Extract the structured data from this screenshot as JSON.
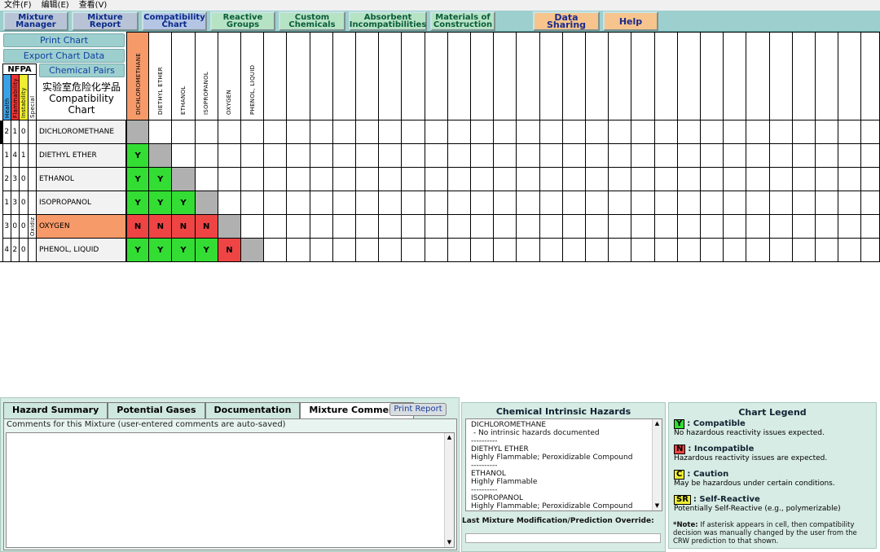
{
  "menu": [
    "文件(F)",
    "编辑(E)",
    "查看(V)"
  ],
  "nav": [
    {
      "label": "Mixture\nManager",
      "style": "grey"
    },
    {
      "label": "Mixture\nReport",
      "style": "grey"
    },
    {
      "label": "Compatibility\nChart",
      "style": "blue"
    },
    {
      "label": "Reactive\nGroups",
      "style": "green"
    },
    {
      "label": "Custom\nChemicals",
      "style": "green"
    },
    {
      "label": "Absorbent\nIncompatibilities",
      "style": "green"
    },
    {
      "label": "Materials of\nConstruction",
      "style": "green"
    },
    {
      "label": "Data Sharing",
      "style": "orange"
    },
    {
      "label": "Help",
      "style": "orange"
    }
  ],
  "left_buttons": {
    "print_chart": "Print Chart",
    "export_chart_data": "Export Chart Data",
    "chemical_pairs": "Chemical Pairs"
  },
  "nfpa": {
    "title": "NFPA",
    "headers": [
      "Health",
      "Flammability",
      "Instability",
      "Special"
    ]
  },
  "chart_title": "实验室危险化学品\nCompatibility\nChart",
  "chemicals": [
    {
      "name": "DICHLOROMETHANE",
      "health": "2",
      "flammability": "1",
      "instability": "0",
      "special": "",
      "highlight": false
    },
    {
      "name": "DIETHYL ETHER",
      "health": "1",
      "flammability": "4",
      "instability": "1",
      "special": "",
      "highlight": false
    },
    {
      "name": "ETHANOL",
      "health": "2",
      "flammability": "3",
      "instability": "0",
      "special": "",
      "highlight": false
    },
    {
      "name": "ISOPROPANOL",
      "health": "1",
      "flammability": "3",
      "instability": "0",
      "special": "",
      "highlight": false
    },
    {
      "name": "OXYGEN",
      "health": "3",
      "flammability": "0",
      "instability": "0",
      "special": "Oxidiz",
      "highlight": true
    },
    {
      "name": "PHENOL, LIQUID",
      "health": "4",
      "flammability": "2",
      "instability": "0",
      "special": "",
      "highlight": false
    }
  ],
  "matrix": [
    [],
    [
      "Y"
    ],
    [
      "Y",
      "Y"
    ],
    [
      "Y",
      "Y",
      "Y"
    ],
    [
      "N",
      "N",
      "N",
      "N"
    ],
    [
      "Y",
      "Y",
      "Y",
      "Y",
      "N"
    ]
  ],
  "colors": {
    "Y": "#33dd33",
    "N": "#ee4444",
    "diagonal": "#b0b0b0",
    "highlight": "#f79a6a",
    "health": "#3aa0e8",
    "flammability": "#ee3333",
    "instability": "#eeee33",
    "special": "#ffffff"
  },
  "tabs": [
    "Hazard Summary",
    "Potential Gases",
    "Documentation",
    "Mixture Comments"
  ],
  "active_tab": "Mixture Comments",
  "print_report": "Print Report",
  "comments": {
    "caption": "Comments for this Mixture (user-entered comments are auto-saved)",
    "value": ""
  },
  "hazards": {
    "title": "Chemical Intrinsic Hazards",
    "lines": [
      "DICHLOROMETHANE",
      " - No intrinsic hazards documented",
      "----------",
      "DIETHYL ETHER",
      "Highly Flammable; Peroxidizable Compound",
      "----------",
      "ETHANOL",
      "Highly Flammable",
      "----------",
      "ISOPROPANOL",
      "Highly Flammable; Peroxidizable Compound",
      "----------"
    ]
  },
  "override": {
    "label": "Last Mixture Modification/Prediction Override:",
    "value": ""
  },
  "legend": {
    "title": "Chart Legend",
    "items": [
      {
        "code": "Y",
        "name": ": Compatible",
        "desc": "No hazardous reactivity issues expected.",
        "color": "#33dd33"
      },
      {
        "code": "N",
        "name": ": Incompatible",
        "desc": "Hazardous reactivity issues are expected.",
        "color": "#ee4444"
      },
      {
        "code": "C",
        "name": ": Caution",
        "desc": "May be hazardous under certain conditions.",
        "color": "#eeee33"
      },
      {
        "code": "SR",
        "name": ":  Self-Reactive",
        "desc": "Potentially Self-Reactive (e.g., polymerizable)",
        "color": "#eeee33"
      }
    ],
    "note_bold": "*Note:",
    "note": " If asterisk appears in cell, then compatibility decision was manually changed by the user from the CRW prediction to that shown."
  }
}
